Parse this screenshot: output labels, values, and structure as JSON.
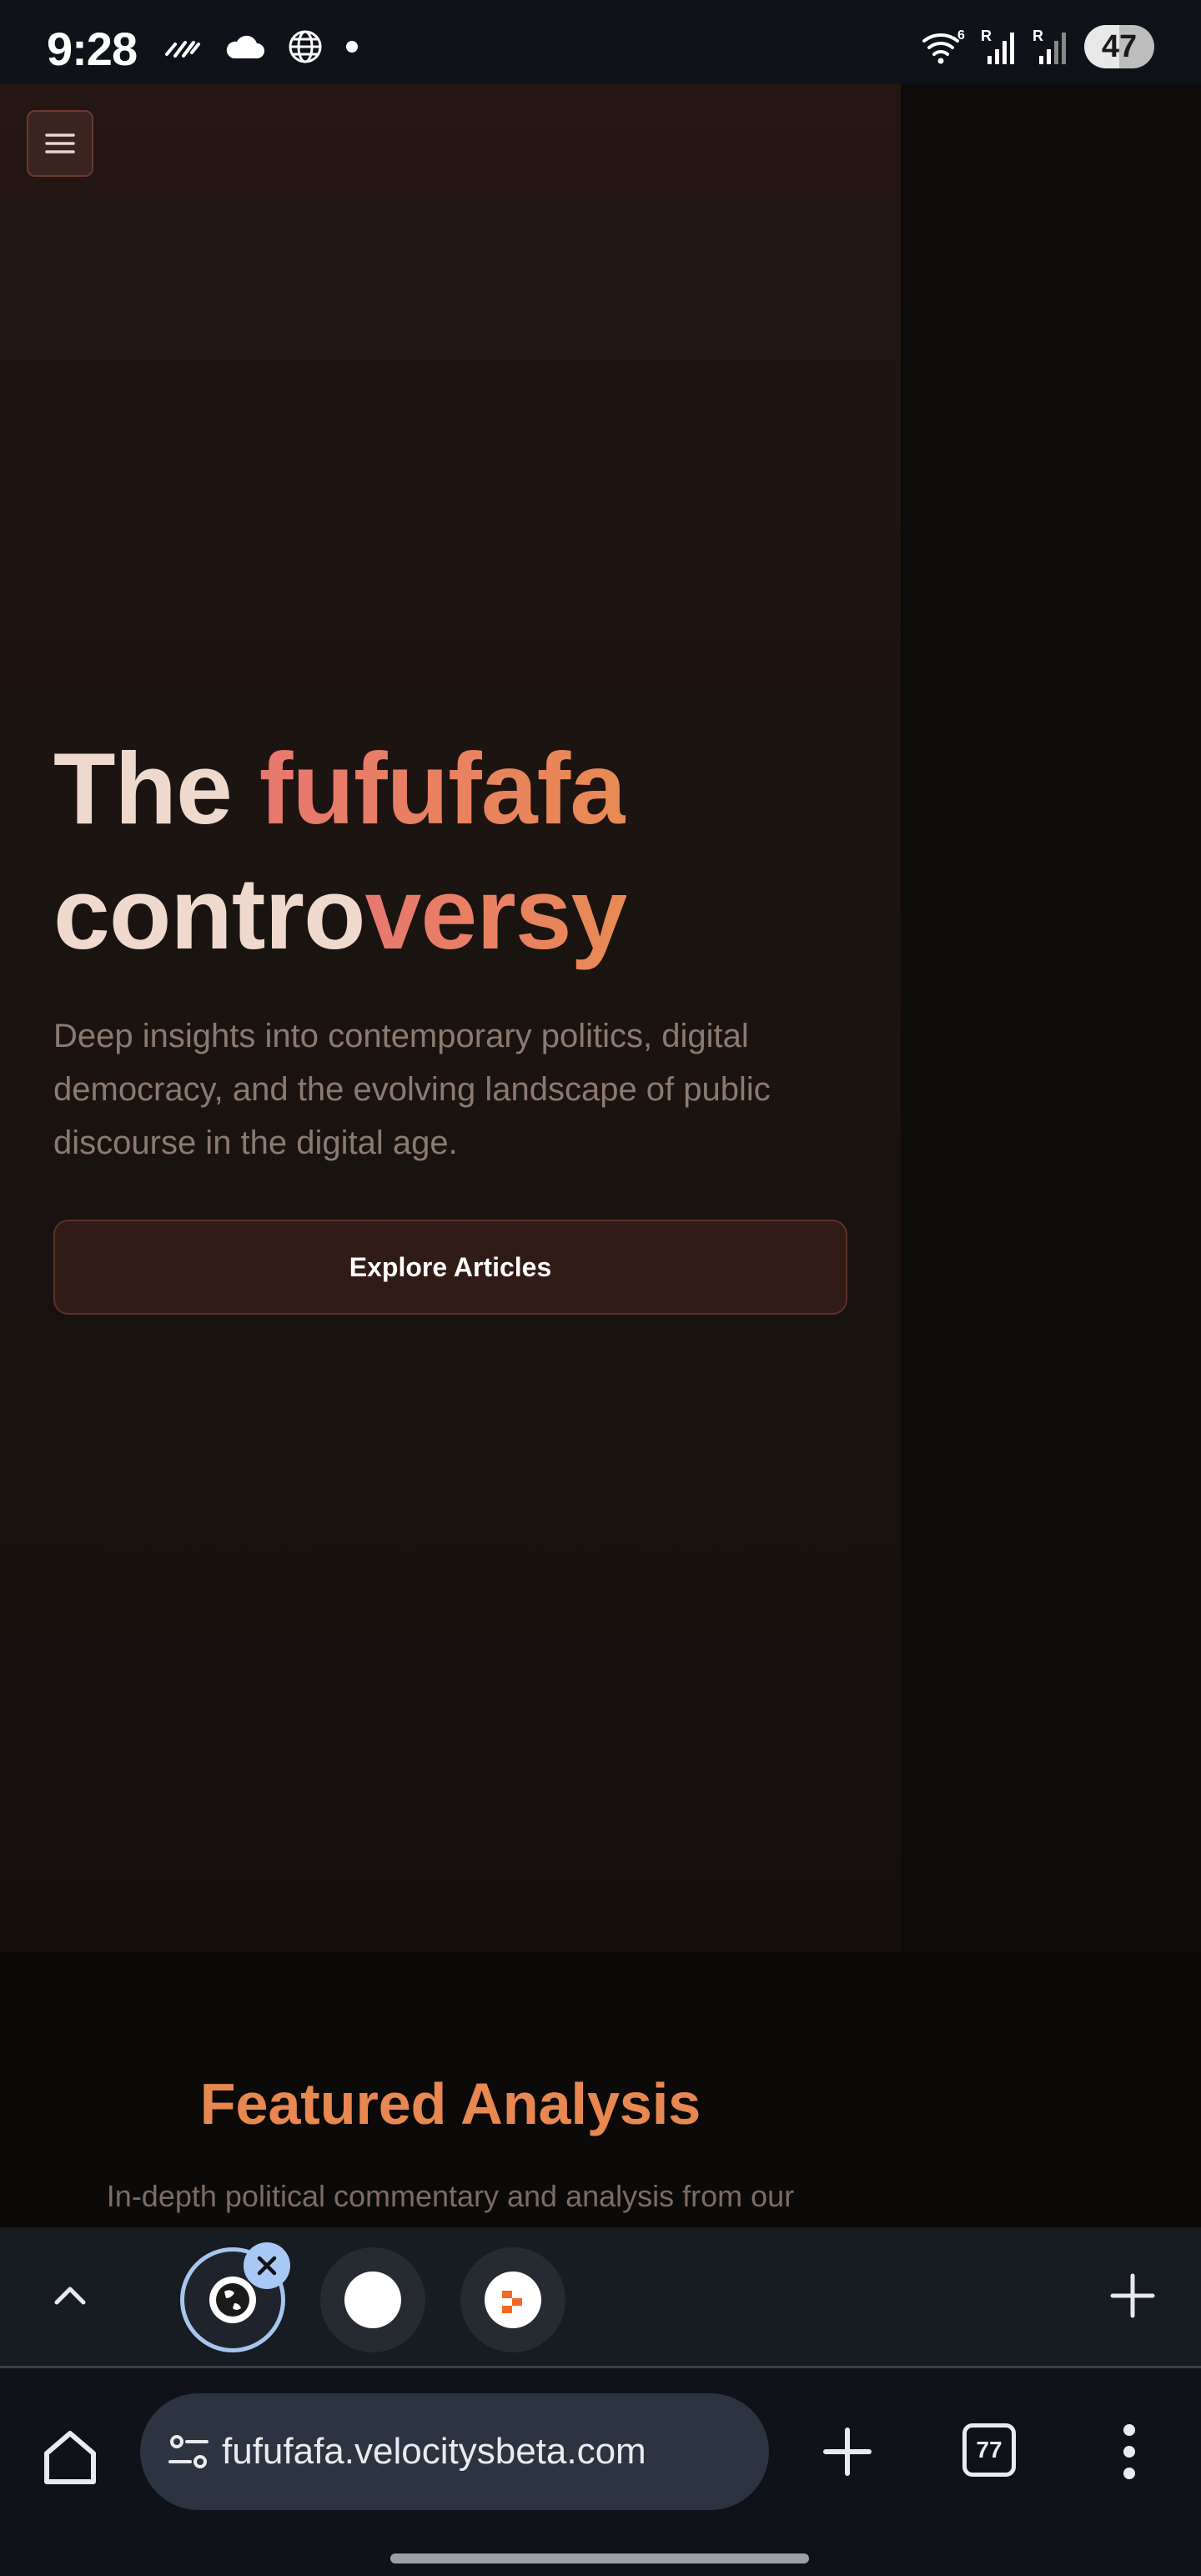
{
  "status_bar": {
    "time": "9:28",
    "left_icons": [
      "weather-stripes-icon",
      "cloud-icon",
      "globe-icon",
      "dot-icon"
    ],
    "right_icons": [
      "wifi-icon",
      "signal-r-icon",
      "signal-r-icon"
    ],
    "battery": "47"
  },
  "hero": {
    "title_part1": "The ",
    "title_highlight": "fufufafa",
    "title_line2_plain": "contro",
    "title_line2_highlight": "versy",
    "subtitle": "Deep insights into contemporary politics, digital democracy, and the evolving landscape of public discourse in the digital age.",
    "cta_label": "Explore Articles"
  },
  "featured": {
    "title": "Featured Analysis",
    "subtitle": "In-depth political commentary and analysis from our"
  },
  "tab_strip": {
    "tabs": [
      {
        "icon": "globe-icon",
        "active": true
      },
      {
        "icon": "blank-circle-icon",
        "active": false
      },
      {
        "icon": "site-logo-icon",
        "active": false
      }
    ]
  },
  "toolbar": {
    "url": "fufufafa.velocitysbeta.com",
    "tabs_count": "77"
  },
  "colors": {
    "accent_start": "#e7786f",
    "accent_end": "#e88a54",
    "button_bg": "#311b17",
    "tab_active_ring": "#a7c6ef"
  }
}
